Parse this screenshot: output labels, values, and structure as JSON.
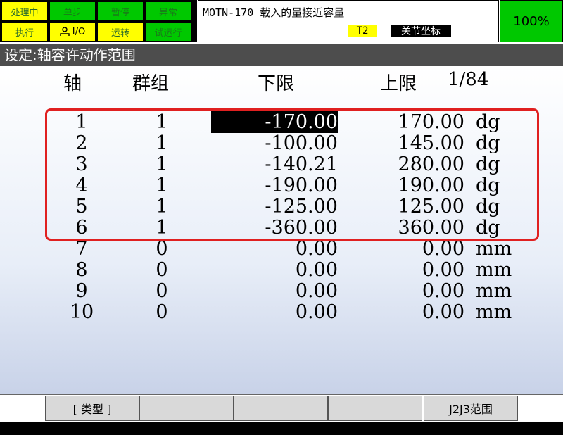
{
  "status": {
    "row1": [
      "处理中",
      "单步",
      "暂停",
      "异常"
    ],
    "row2": [
      "执行",
      "I/O",
      "运转",
      "试运行"
    ]
  },
  "message": {
    "text": "MOTN-170 载入的量接近容量",
    "mode": "T2",
    "coord": "关节坐标"
  },
  "override": "100%",
  "screen_title": "设定:轴容许动作范围",
  "table": {
    "headers": {
      "axis": "轴",
      "group": "群组",
      "lower": "下限",
      "upper": "上限",
      "page": "1/84"
    },
    "rows": [
      {
        "axis": "1",
        "group": "1",
        "lower": "-170.00",
        "upper": "170.00",
        "unit": "dg"
      },
      {
        "axis": "2",
        "group": "1",
        "lower": "-100.00",
        "upper": "145.00",
        "unit": "dg"
      },
      {
        "axis": "3",
        "group": "1",
        "lower": "-140.21",
        "upper": "280.00",
        "unit": "dg"
      },
      {
        "axis": "4",
        "group": "1",
        "lower": "-190.00",
        "upper": "190.00",
        "unit": "dg"
      },
      {
        "axis": "5",
        "group": "1",
        "lower": "-125.00",
        "upper": "125.00",
        "unit": "dg"
      },
      {
        "axis": "6",
        "group": "1",
        "lower": "-360.00",
        "upper": "360.00",
        "unit": "dg"
      },
      {
        "axis": "7",
        "group": "0",
        "lower": "0.00",
        "upper": "0.00",
        "unit": "mm"
      },
      {
        "axis": "8",
        "group": "0",
        "lower": "0.00",
        "upper": "0.00",
        "unit": "mm"
      },
      {
        "axis": "9",
        "group": "0",
        "lower": "0.00",
        "upper": "0.00",
        "unit": "mm"
      },
      {
        "axis": "10",
        "group": "0",
        "lower": "0.00",
        "upper": "0.00",
        "unit": "mm"
      }
    ]
  },
  "function_keys": [
    "[ 类型 ]",
    "",
    "",
    "",
    "J2J3范围"
  ],
  "colors": {
    "status_green": "#00c800",
    "status_yellow": "#ffff00",
    "highlight": "#e02020",
    "title_bar": "#4d4d4d"
  }
}
